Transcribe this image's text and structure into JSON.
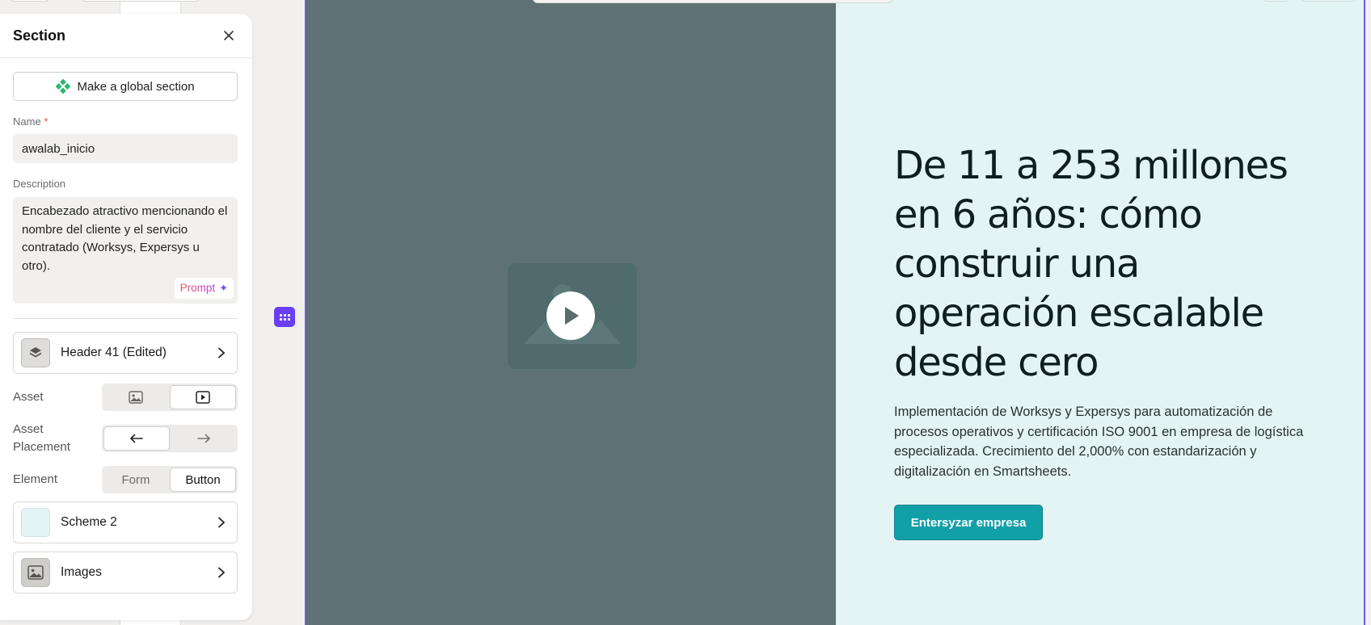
{
  "panel": {
    "title": "Section",
    "global_button_label": "Make a global section",
    "name_label": "Name",
    "name_required_mark": "*",
    "name_value": "awalab_inicio",
    "description_label": "Description",
    "description_value": "Encabezado atractivo mencionando el nombre del cliente y el servicio contratado (Worksys, Expersys u otro).",
    "prompt_label": "Prompt",
    "layout_row_label": "Header 41 (Edited)",
    "asset_label": "Asset",
    "asset_options": [
      "image",
      "video"
    ],
    "asset_selected": "video",
    "asset_placement_label": "Asset Placement",
    "placement_options": [
      "left",
      "right"
    ],
    "placement_selected": "left",
    "element_label": "Element",
    "element_options": [
      "Form",
      "Button"
    ],
    "element_selected": "Button",
    "scheme_row_label": "Scheme 2",
    "images_row_label": "Images"
  },
  "canvas": {
    "headline": "De 11 a 253 millones en 6 años: cómo construir una operación escalable desde cero",
    "subtext": "Implementación de Worksys y Expersys para automatización de procesos operativos y certificación ISO 9001 en empresa de logística especializada. Crecimiento del 2,000% con estandarización y digitalización en Smartsheets.",
    "cta_label": "Entersyzar empresa"
  },
  "colors": {
    "accent": "#6a3ff5",
    "cta": "#12a0a8",
    "canvas_bg": "#e4f3f3",
    "media_bg": "#5f7273"
  }
}
